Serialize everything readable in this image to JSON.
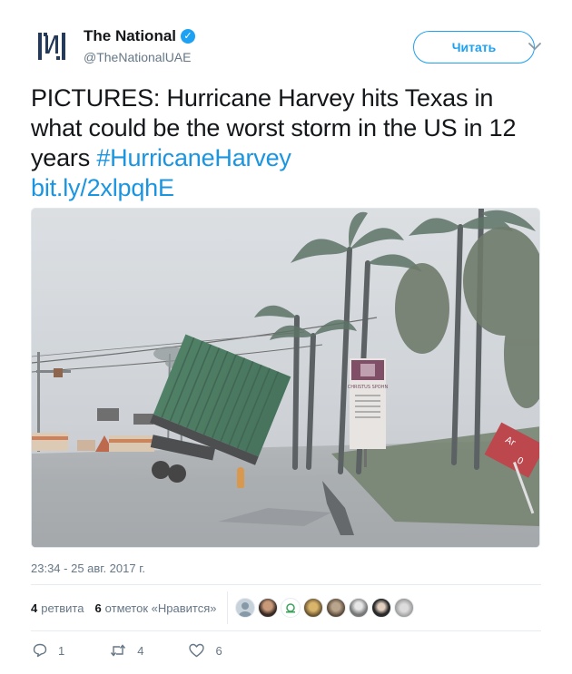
{
  "account": {
    "display_name": "The National",
    "handle": "@TheNationalUAE",
    "verified_icon": "verified-badge-icon",
    "avatar_icon": "the-national-logo-icon",
    "brand_color": "#253a59"
  },
  "follow_button": {
    "label": "Читать"
  },
  "tweet": {
    "text": "PICTURES: Hurricane Harvey hits Texas in what could be the worst storm in the US in 12 years",
    "hashtag": "#HurricaneHarvey",
    "link": "bit.ly/2xlpqhE"
  },
  "photo": {
    "sign_text_1": "CHRISTUS SPOHN",
    "sign_text_2": "Ar",
    "sign_text_3": "0"
  },
  "timestamp": "23:34 - 25 авг. 2017 г.",
  "stats": {
    "retweets_count": "4",
    "retweets_label": "ретвита",
    "likes_count": "6",
    "likes_label": "отметок «Нравится»"
  },
  "actions": {
    "reply_count": "1",
    "retweet_count": "4",
    "like_count": "6"
  },
  "colors": {
    "accent": "#1da1f2",
    "link": "#1b95e0",
    "muted": "#657786"
  }
}
